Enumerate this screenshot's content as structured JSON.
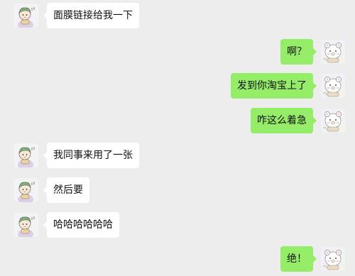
{
  "colors": {
    "background": "#ededed",
    "incoming_bubble": "#ffffff",
    "outgoing_bubble": "#95ec69"
  },
  "icons": {
    "incoming_avatar": "cartoon-girl-with-green-hair-avatar",
    "outgoing_avatar": "cartoon-white-bear-avatar"
  },
  "messages": [
    {
      "side": "left",
      "text": "面膜链接给我一下"
    },
    {
      "side": "right",
      "text": "啊？"
    },
    {
      "side": "right",
      "text": "发到你淘宝上了"
    },
    {
      "side": "right",
      "text": "咋这么着急"
    },
    {
      "side": "left",
      "text": "我同事来用了一张"
    },
    {
      "side": "left",
      "text": "然后要"
    },
    {
      "side": "left",
      "text": "哈哈哈哈哈哈"
    },
    {
      "side": "right",
      "text": "绝！"
    }
  ]
}
